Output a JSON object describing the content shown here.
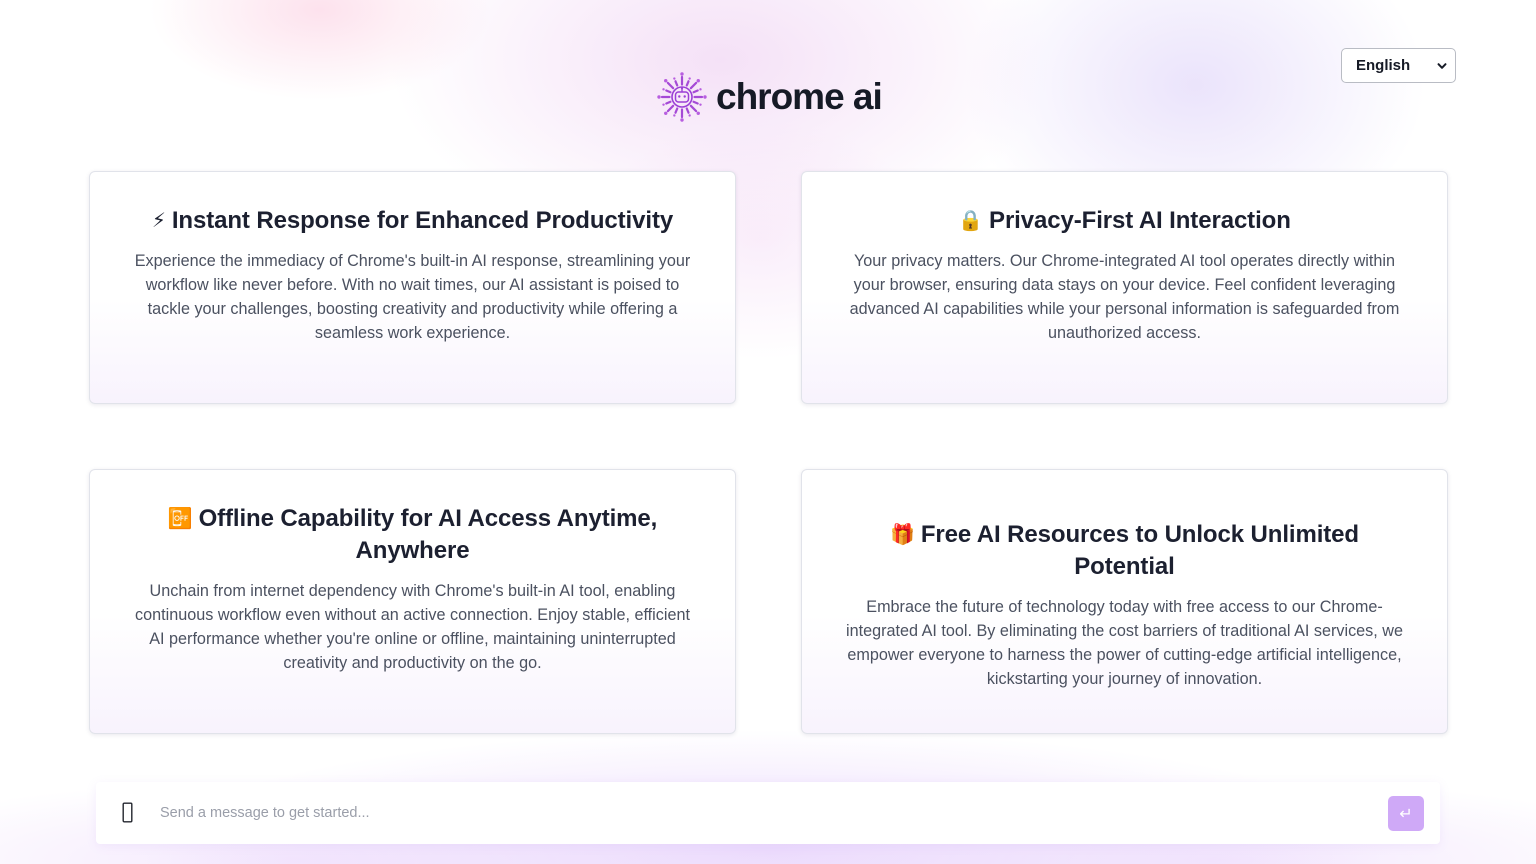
{
  "header": {
    "brand_name": "chrome ai",
    "logo_icon": "sparkle-robot-logo",
    "accent_color": "#9b3fd6"
  },
  "language_select": {
    "selected": "English",
    "icon": "chevron-down-icon"
  },
  "features": [
    {
      "emoji": "⚡",
      "title": "Instant Response for Enhanced Productivity",
      "text": "Experience the immediacy of Chrome's built-in AI response, streamlining your workflow like never before. With no wait times, our AI assistant is poised to tackle your challenges, boosting creativity and productivity while offering a seamless work experience."
    },
    {
      "emoji": "🔒",
      "title": "Privacy-First AI Interaction",
      "text": "Your privacy matters. Our Chrome-integrated AI tool operates directly within your browser, ensuring data stays on your device. Feel confident leveraging advanced AI capabilities while your personal information is safeguarded from unauthorized access."
    },
    {
      "emoji": "📴",
      "title": "Offline Capability for AI Access Anytime, Anywhere",
      "text": "Unchain from internet dependency with Chrome's built-in AI tool, enabling continuous workflow even without an active connection. Enjoy stable, efficient AI performance whether you're online or offline, maintaining uninterrupted creativity and productivity on the go."
    },
    {
      "emoji": "🎁",
      "title": "Free AI Resources to Unlock Unlimited Potential",
      "text": "Embrace the future of technology today with free access to our Chrome-integrated AI tool. By eliminating the cost barriers of traditional AI services, we empower everyone to harness the power of cutting-edge artificial intelligence, kickstarting your journey of innovation."
    }
  ],
  "chat": {
    "placeholder": "Send a message to get started...",
    "value": "",
    "attach_icon": "paperclip-icon",
    "send_icon": "enter-return-icon",
    "send_label": "↵",
    "send_color": "#cfa9f7"
  }
}
